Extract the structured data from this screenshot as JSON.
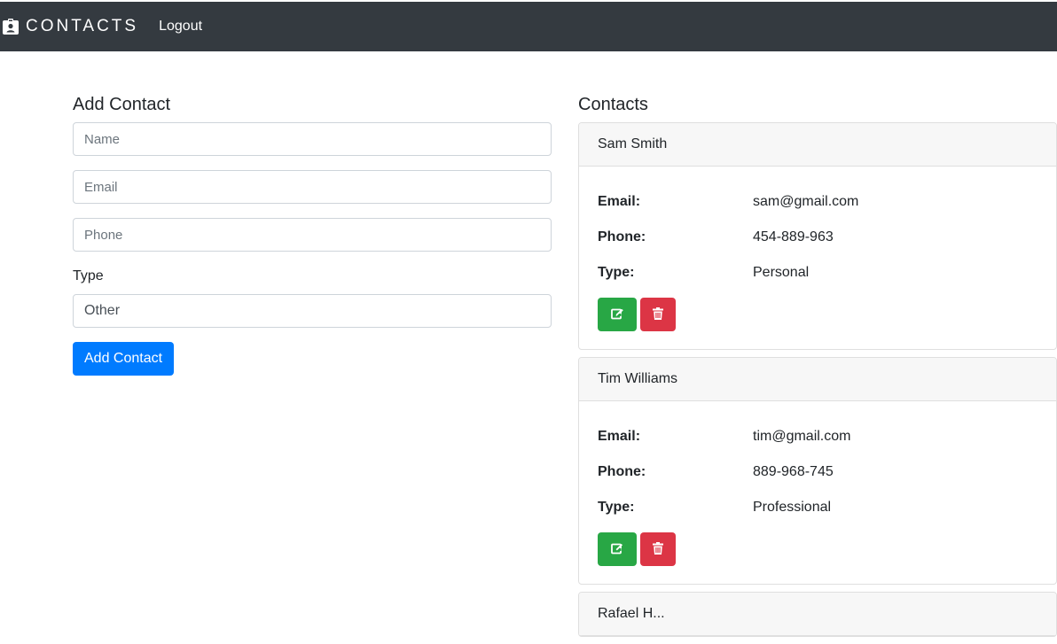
{
  "navbar": {
    "brand": "CONTACTS",
    "logout": "Logout"
  },
  "form": {
    "title": "Add Contact",
    "name_placeholder": "Name",
    "email_placeholder": "Email",
    "phone_placeholder": "Phone",
    "type_label": "Type",
    "type_value": "Other",
    "submit_label": "Add Contact"
  },
  "list": {
    "title": "Contacts",
    "labels": {
      "email": "Email:",
      "phone": "Phone:",
      "type": "Type:"
    },
    "contacts": [
      {
        "name": "Sam Smith",
        "email": "sam@gmail.com",
        "phone": "454-889-963",
        "type": "Personal"
      },
      {
        "name": "Tim Williams",
        "email": "tim@gmail.com",
        "phone": "889-968-745",
        "type": "Professional"
      }
    ],
    "third_partial_name": "Rafael H..."
  },
  "colors": {
    "navbar": "#343a40",
    "primary": "#007bff",
    "success": "#28a745",
    "danger": "#dc3545"
  },
  "icons": {
    "brand": "id-badge-icon",
    "edit": "edit-icon",
    "delete": "trash-icon"
  }
}
